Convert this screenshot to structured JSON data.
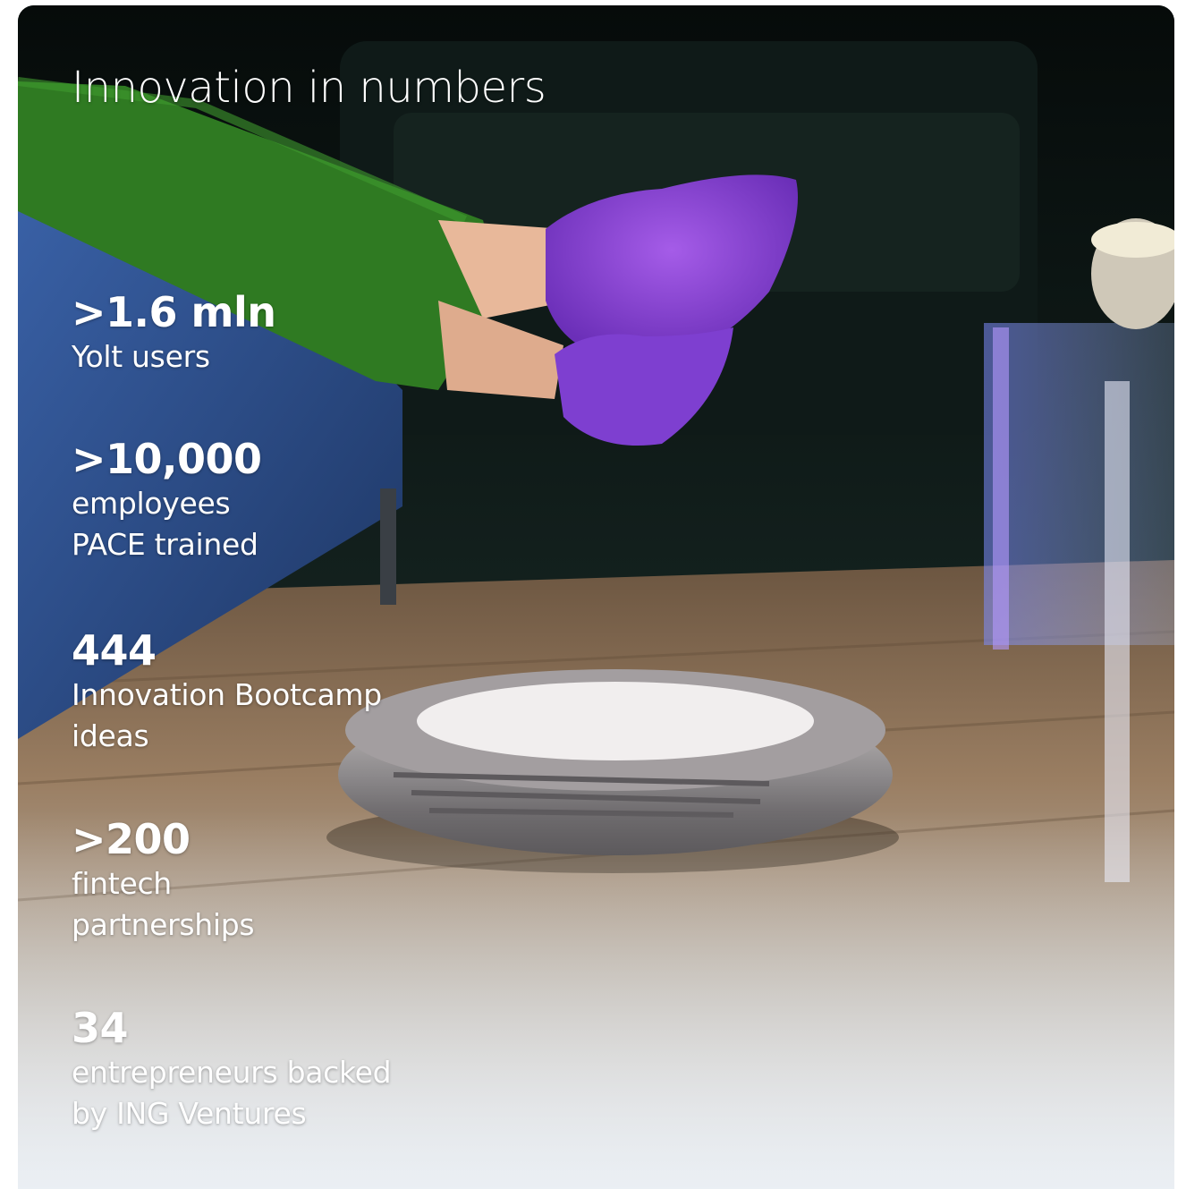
{
  "title": "Innovation in numbers",
  "stats": [
    {
      "value": ">1.6 mln",
      "label_lines": [
        "Yolt users"
      ]
    },
    {
      "value": ">10,000",
      "label_lines": [
        "employees",
        "PACE trained"
      ]
    },
    {
      "value": "444",
      "label_lines": [
        "Innovation Bootcamp",
        "ideas"
      ]
    },
    {
      "value": ">200",
      "label_lines": [
        "fintech",
        "partnerships"
      ]
    },
    {
      "value": "34",
      "label_lines": [
        "entrepreneurs backed",
        "by ING Ventures"
      ]
    }
  ],
  "colors": {
    "text": "#ffffff",
    "sock": "#8a3fd6",
    "leggings": "#2f7a22",
    "sofa": "#2c4f8c",
    "floor": "#9a7e62"
  }
}
